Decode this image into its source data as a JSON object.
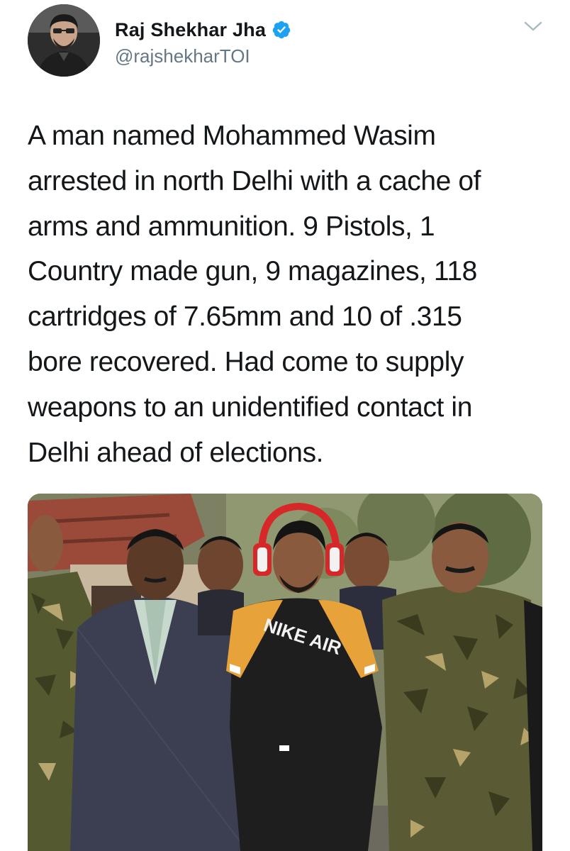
{
  "author": {
    "display_name": "Raj Shekhar Jha",
    "handle": "@rajshekharTOI",
    "verified": true
  },
  "tweet": {
    "text": "A man named Mohammed Wasim\narrested in north Delhi with a cache of\narms and ammunition. 9 Pistols, 1\nCountry made gun, 9 magazines, 118\ncartridges of 7.65mm and 10 of .315\nbore recovered. Had come to supply\nweapons to an unidentified contact in\nDelhi ahead of elections."
  },
  "media": {
    "shirt_print": "NIKE AIR"
  },
  "icons": {
    "verified": "verified-badge-icon",
    "menu": "chevron-down-icon"
  },
  "colors": {
    "verified_blue": "#1da1f2",
    "name_text": "#14171a",
    "handle_text": "#657786"
  }
}
